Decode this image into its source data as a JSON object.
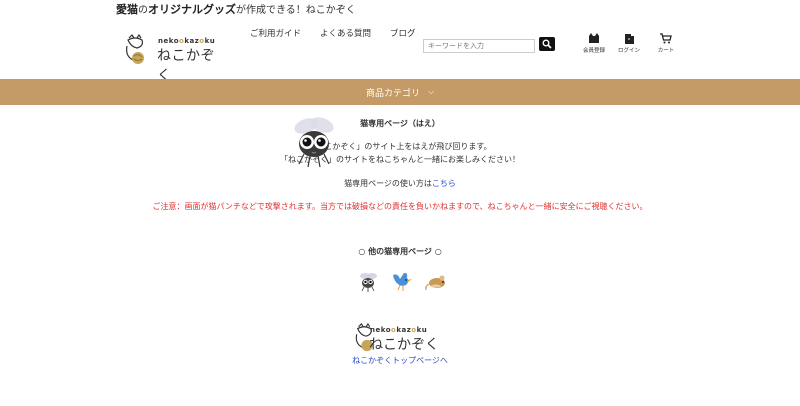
{
  "header": {
    "tagline_bold1": "愛猫",
    "tagline_mid": "の",
    "tagline_bold2": "オリジナルグッズ",
    "tagline_rest": "が作成できる！ねこかぞく",
    "logo_roman_a": "neko",
    "logo_roman_o": "o",
    "logo_roman_b": "kaz",
    "logo_roman_c": "ku",
    "logo_kana": "ねこかぞく",
    "nav": [
      "ご利用ガイド",
      "よくある質問",
      "ブログ"
    ],
    "search_placeholder": "キーワードを入力",
    "icons": [
      {
        "name": "member-icon",
        "label": "会員登録"
      },
      {
        "name": "login-icon",
        "label": "ログイン"
      },
      {
        "name": "cart-icon",
        "label": "カート"
      }
    ]
  },
  "category_bar": {
    "label": "商品カテゴリ",
    "chevron": "⌵"
  },
  "page": {
    "title": "猫専用ページ（はえ）",
    "line1": "「ねこかぞく」のサイト上をはえが飛び回ります。",
    "line2": "「ねこかぞく」のサイトをねこちゃんと一緒にお楽しみください！",
    "howto_text": "猫専用ページの使い方は",
    "howto_link": "こちら",
    "warning": "ご注意：画面が猫パンチなどで攻撃されます。当方では破損などの責任を負いかねますので、ねこちゃんと一緒に安全にご視聴ください。"
  },
  "other_pages": {
    "title": "○ 他の猫専用ページ ○",
    "items": [
      {
        "name": "fly-page-icon"
      },
      {
        "name": "bird-page-icon"
      },
      {
        "name": "mouse-page-icon"
      }
    ]
  },
  "footer": {
    "logo_roman_a": "neko",
    "logo_roman_o": "o",
    "logo_roman_b": "kaz",
    "logo_roman_c": "ku",
    "logo_kana": "ねこかぞく",
    "top_link": "ねこかぞくトップページへ"
  },
  "colors": {
    "accent_bar": "#c49a67",
    "link": "#2a4bcc",
    "warning": "#e03030"
  }
}
